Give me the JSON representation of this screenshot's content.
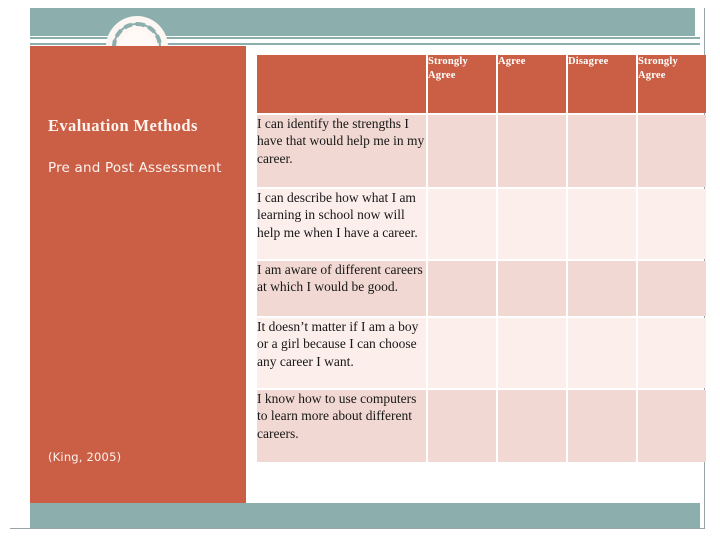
{
  "slide": {
    "panel": {
      "title": "Evaluation Methods",
      "subtitle": "Pre and Post Assessment",
      "citation": "(King, 2005)"
    },
    "decor": {
      "circle_icon": "circle-ring-decoration",
      "band_color_teal": "#8CAFAE",
      "panel_color_terracotta": "#CB5F45",
      "row_color_dark": "#F1D8D2",
      "row_color_light": "#FBEEEB"
    },
    "table": {
      "headers": [
        "",
        "Strongly Agree",
        "Agree",
        "Disagree",
        "Strongly Agree"
      ],
      "rows": [
        {
          "statement": "I can identify the strengths I have that would help me in my career."
        },
        {
          "statement": "I can describe how what I am learning in school now will help me when I have a career."
        },
        {
          "statement": "I am aware of different careers at which I would be good."
        },
        {
          "statement": "It doesn’t matter if I am a boy or a girl because I can choose any career I want."
        },
        {
          "statement": "I know how to use computers to learn more about different careers."
        }
      ]
    }
  }
}
